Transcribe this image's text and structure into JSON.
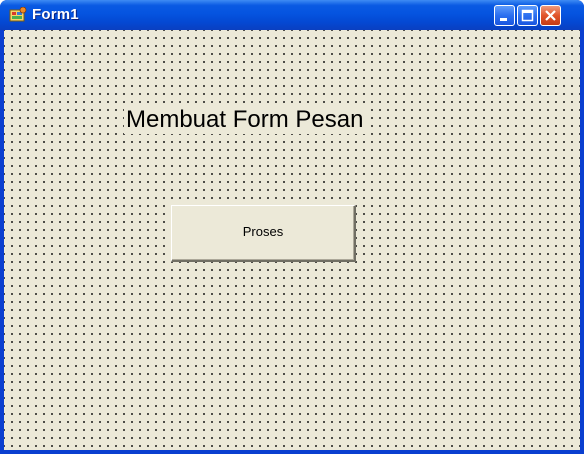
{
  "window": {
    "title": "Form1",
    "controls": {
      "minimize": "minimize-icon",
      "maximize": "maximize-icon",
      "close": "close-icon"
    }
  },
  "form": {
    "label_text": "Membuat Form Pesan",
    "button_label": "Proses"
  },
  "colors": {
    "titlebar": "#0554e0",
    "client_background": "#ece9d8",
    "close_button": "#e1542a"
  }
}
